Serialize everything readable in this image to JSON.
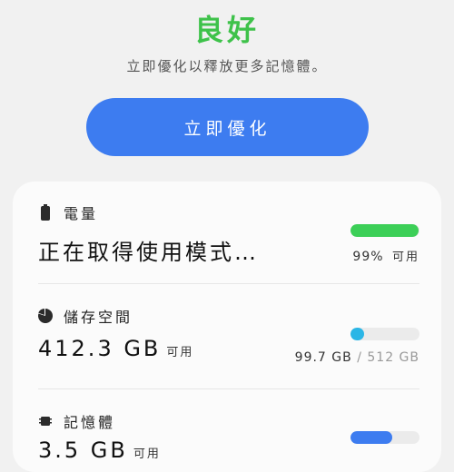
{
  "header": {
    "status": "良好",
    "status_color": "#3ec24a",
    "subtitle": "立即優化以釋放更多記憶體。"
  },
  "optimize_button": {
    "label": "立即優化",
    "color": "#3d7cf0"
  },
  "battery": {
    "icon": "battery-icon",
    "label": "電量",
    "mode_text": "正在取得使用模式…",
    "percent_text": "99%",
    "available_label": "可用",
    "level": 0.99,
    "bar_color": "#3ccf57"
  },
  "storage": {
    "icon": "pie-chart-icon",
    "label": "儲存空間",
    "available_value": "412.3 GB",
    "available_label": "可用",
    "used": "99.7 GB",
    "separator": "/",
    "total": "512 GB",
    "level": 0.195,
    "bar_color": "#2bb6e6"
  },
  "memory": {
    "icon": "memory-chip-icon",
    "label": "記憶體",
    "available_value": "3.5 GB",
    "available_label": "可用",
    "level": 0.6,
    "bar_color": "#3d7cf0"
  }
}
